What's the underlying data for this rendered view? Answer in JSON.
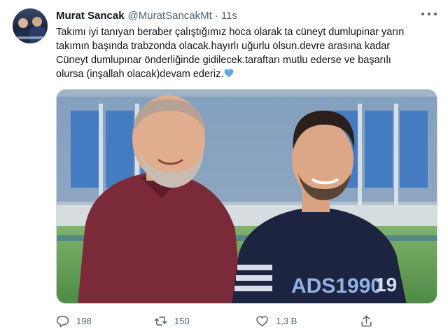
{
  "tweet": {
    "display_name": "Murat Sancak",
    "handle": "@MuratSancakMt",
    "separator": "·",
    "time": "11s",
    "text_lines": [
      "Takımı iyi tanıyan beraber çalıştığımız hoca olarak ta cüneyt dumlupinar yarın",
      "takımın başında trabzonda olacak.hayırlı uğurlu olsun.devre arasına kadar",
      "Cüneyt dumlupınar önderliğinde gidilecek.taraftarı mutlu ederse ve başarılı",
      "olursa (inşallah olacak)devam ederiz."
    ],
    "emoji": "blue-heart",
    "shirt_text": "ADS1990",
    "shirt_number": "19"
  },
  "actions": {
    "reply_count": "198",
    "retweet_count": "150",
    "like_count": "1,3 B"
  },
  "icons": [
    "more-icon",
    "reply-icon",
    "retweet-icon",
    "like-icon",
    "share-icon"
  ],
  "colors": {
    "text": "#0f1419",
    "secondary": "#536471",
    "heart": "#5ea9dd"
  }
}
